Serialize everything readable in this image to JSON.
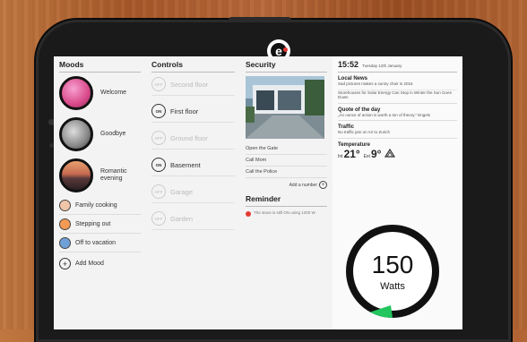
{
  "moods": {
    "title": "Moods",
    "large": [
      {
        "label": "Welcome"
      },
      {
        "label": "Goodbye"
      },
      {
        "label": "Romantic\nevening"
      }
    ],
    "small": [
      {
        "label": "Family cooking"
      },
      {
        "label": "Stepping out"
      },
      {
        "label": "Off to vacation"
      }
    ],
    "add_label": "Add Mood"
  },
  "controls": {
    "title": "Controls",
    "items": [
      {
        "label": "Second floor",
        "state": "OFF"
      },
      {
        "label": "First floor",
        "state": "ON"
      },
      {
        "label": "Ground floor",
        "state": "OFF"
      },
      {
        "label": "Basement",
        "state": "ON"
      },
      {
        "label": "Garage",
        "state": "OFF"
      },
      {
        "label": "Garden",
        "state": "OFF"
      }
    ]
  },
  "security": {
    "title": "Security",
    "actions": [
      "Open the Gate",
      "Call Mom",
      "Call the Police"
    ],
    "add_number": "Add a number"
  },
  "reminder": {
    "title": "Reminder",
    "text": "The stove is still ON using 1200 W"
  },
  "info": {
    "time": "15:52",
    "date": "Tuesday 12th January",
    "news_title": "Local News",
    "news_text": "Sad pictures makes a sunny chair in 2016",
    "news_text2": "Storehouses for Solar Energy Can Stop in Winter the Sun Goes Down",
    "quote_title": "Quote of the day",
    "quote_text": "„An ounce of action is worth a ton of theory.” Engels",
    "traffic_title": "Traffic",
    "traffic_text": "No traffic jam on A2 to Zurich",
    "temp_title": "Temperature",
    "temp_int_label": "Int",
    "temp_int": "21°",
    "temp_ext_label": "Ext",
    "temp_ext": "9°",
    "power_value": "150",
    "power_unit": "Watts",
    "power_fraction": 0.08
  },
  "colors": {
    "gauge_accent": "#22c55e"
  }
}
